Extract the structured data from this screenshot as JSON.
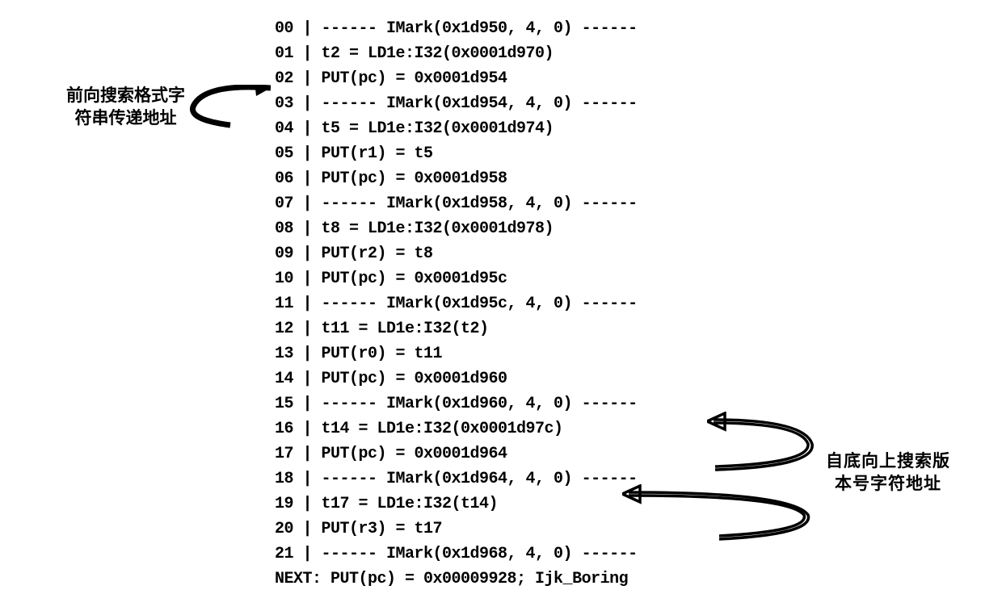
{
  "code": {
    "lines": [
      "00 | ------ IMark(0x1d950, 4, 0) ------",
      "01 | t2 = LD1e:I32(0x0001d970)",
      "02 | PUT(pc) = 0x0001d954",
      "03 | ------ IMark(0x1d954, 4, 0) ------",
      "04 | t5 = LD1e:I32(0x0001d974)",
      "05 | PUT(r1) = t5",
      "06 | PUT(pc) = 0x0001d958",
      "07 | ------ IMark(0x1d958, 4, 0) ------",
      "08 | t8 = LD1e:I32(0x0001d978)",
      "09 | PUT(r2) = t8",
      "10 | PUT(pc) = 0x0001d95c",
      "11 | ------ IMark(0x1d95c, 4, 0) ------",
      "12 | t11 = LD1e:I32(t2)",
      "13 | PUT(r0) = t11",
      "14 | PUT(pc) = 0x0001d960",
      "15 | ------ IMark(0x1d960, 4, 0) ------",
      "16 | t14 = LD1e:I32(0x0001d97c)",
      "17 | PUT(pc) = 0x0001d964",
      "18 | ------ IMark(0x1d964, 4, 0) ------",
      "19 | t17 = LD1e:I32(t14)",
      "20 | PUT(r3) = t17",
      "21 | ------ IMark(0x1d968, 4, 0) ------",
      "NEXT: PUT(pc) = 0x00009928; Ijk_Boring"
    ]
  },
  "labels": {
    "left_line1": "前向搜索格式字",
    "left_line2": "符串传递地址",
    "right_line1": "自底向上搜索版",
    "right_line2": "本号字符地址"
  }
}
